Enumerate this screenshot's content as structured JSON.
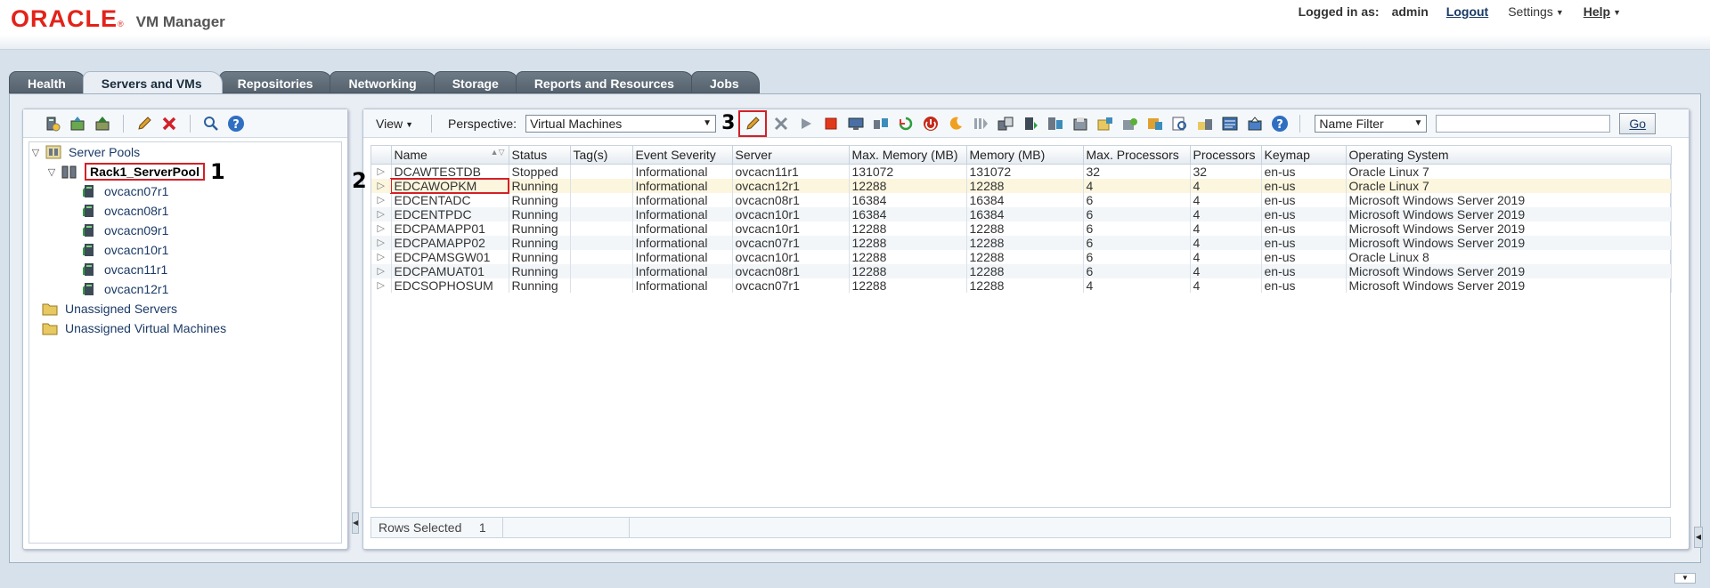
{
  "header": {
    "logo_brand": "ORACLE",
    "logo_mark": "®",
    "product": "VM Manager",
    "logged_in_label": "Logged in as:",
    "user": "admin",
    "logout": "Logout",
    "settings": "Settings",
    "help": "Help"
  },
  "tabs": [
    {
      "label": "Health",
      "active": false
    },
    {
      "label": "Servers and VMs",
      "active": true
    },
    {
      "label": "Repositories",
      "active": false
    },
    {
      "label": "Networking",
      "active": false
    },
    {
      "label": "Storage",
      "active": false
    },
    {
      "label": "Reports and Resources",
      "active": false
    },
    {
      "label": "Jobs",
      "active": false
    }
  ],
  "tree": {
    "root": "Server Pools",
    "pool": "Rack1_ServerPool",
    "pool_annotation": "1",
    "servers": [
      "ovcacn07r1",
      "ovcacn08r1",
      "ovcacn09r1",
      "ovcacn10r1",
      "ovcacn11r1",
      "ovcacn12r1"
    ],
    "unassigned_servers": "Unassigned Servers",
    "unassigned_vms": "Unassigned Virtual Machines"
  },
  "toolbar": {
    "view": "View",
    "perspective_label": "Perspective:",
    "perspective_value": "Virtual Machines",
    "edit_annotation": "3",
    "filter_type": "Name Filter",
    "filter_value": "",
    "go": "Go"
  },
  "table": {
    "columns": [
      "Name",
      "Status",
      "Tag(s)",
      "Event Severity",
      "Server",
      "Max. Memory (MB)",
      "Memory (MB)",
      "Max. Processors",
      "Processors",
      "Keymap",
      "Operating System"
    ],
    "row_annotation": "2",
    "rows": [
      [
        "DCAWTESTDB",
        "Stopped",
        "",
        "Informational",
        "ovcacn11r1",
        "131072",
        "131072",
        "32",
        "32",
        "en-us",
        "Oracle Linux 7"
      ],
      [
        "EDCAWOPKM",
        "Running",
        "",
        "Informational",
        "ovcacn12r1",
        "12288",
        "12288",
        "4",
        "4",
        "en-us",
        "Oracle Linux 7"
      ],
      [
        "EDCENTADC",
        "Running",
        "",
        "Informational",
        "ovcacn08r1",
        "16384",
        "16384",
        "6",
        "4",
        "en-us",
        "Microsoft Windows Server 2019"
      ],
      [
        "EDCENTPDC",
        "Running",
        "",
        "Informational",
        "ovcacn10r1",
        "16384",
        "16384",
        "6",
        "4",
        "en-us",
        "Microsoft Windows Server 2019"
      ],
      [
        "EDCPAMAPP01",
        "Running",
        "",
        "Informational",
        "ovcacn10r1",
        "12288",
        "12288",
        "6",
        "4",
        "en-us",
        "Microsoft Windows Server 2019"
      ],
      [
        "EDCPAMAPP02",
        "Running",
        "",
        "Informational",
        "ovcacn07r1",
        "12288",
        "12288",
        "6",
        "4",
        "en-us",
        "Microsoft Windows Server 2019"
      ],
      [
        "EDCPAMSGW01",
        "Running",
        "",
        "Informational",
        "ovcacn10r1",
        "12288",
        "12288",
        "6",
        "4",
        "en-us",
        "Oracle Linux 8"
      ],
      [
        "EDCPAMUAT01",
        "Running",
        "",
        "Informational",
        "ovcacn08r1",
        "12288",
        "12288",
        "6",
        "4",
        "en-us",
        "Microsoft Windows Server 2019"
      ],
      [
        "EDCSOPHOSUM",
        "Running",
        "",
        "Informational",
        "ovcacn07r1",
        "12288",
        "12288",
        "4",
        "4",
        "en-us",
        "Microsoft Windows Server 2019"
      ]
    ],
    "selected_row": 1
  },
  "footer": {
    "rows_selected_label": "Rows Selected",
    "rows_selected_count": "1"
  },
  "colors": {
    "brand_red": "#e2231a",
    "highlight_red": "#d32027",
    "tab_dark": "#5f6b76",
    "selected_row": "#fbf6dd"
  }
}
